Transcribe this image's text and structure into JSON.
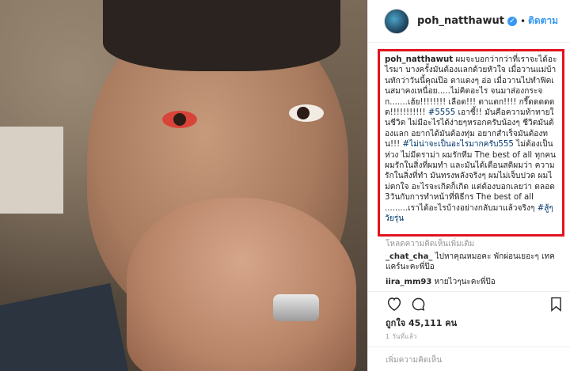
{
  "post": {
    "username": "poh_natthawut",
    "follow_label": "ติดตาม",
    "caption_user": "poh_natthawut",
    "caption_text_1": "ผมจะบอกว่ากว่าที่เราจะได้อะไรมา บางครั้งมันต้องแลกด้วยหัวใจ เมื่อวานแม่บ้านทักว่าวันนี้คุณป๊อ ตาแดงๆ อ่อ เมื่อวานไปทำฟิตเนสมาคงเหนื่อย.....ไม่คิดอะไร จนมาส่องกระจก.......เฮ้ย!!!!!!!! เลือด!!! ตาแตก!!!! กรี๊ดดดดดด!!!!!!!!!!! ",
    "caption_tag_1": "#5555",
    "caption_text_2": " เอาชี้!! มันคือความท้าทายในชีวิต ไม่มีอะไรได้ง่ายๆหรอกครับน้องๆ ชีวิตมันต้องแลก อยากได้มันต้องทุ่ม อยากสำเร็จมันต้องทน!!! ",
    "caption_tag_2": "#ไม่น่าจะเป็นอะไรมากครับ555",
    "caption_text_3": " ไม่ต้องเป็นห่วง ไม่มีดราม่า ผมรักทีม The best of all ทุกคน ผมรักในสิ่งที่ผมทำ และมันได้เตือนสติผมว่า ความรักในสิ่งที่ทำ มันทรงพลังจริงๆ ผมไม่เจ็บปวด ผมไม่ตกใจ อะไรจะเกิดก็เกิด แต่ต้องบอกเลยว่า ตลอด3วันกับการทำหน้าที่พิธีกร The best of all .........เราได้อะไรบ้างอย่างกลับมาแล้วจริงๆ ",
    "caption_tag_3": "#สู้ๆวัยรุ่น",
    "more_comments": "โหลดความคิดเห็นเพิ่มเติม",
    "comments": [
      {
        "user": "_chat_cha_",
        "text": "ไปหาคุณหมอคะ พักผ่อนเยอะๆ เทคแคร์นะคะพี่ป๊อ"
      },
      {
        "user": "iira_mm93",
        "text": "หายไวๆนะคะพี่ป๊อ"
      }
    ],
    "likes": "ถูกใจ 45,111 คน",
    "time": "1 วันที่แล้ว",
    "add_comment_placeholder": "เพิ่มความคิดเห็น"
  },
  "icons": {
    "verified": "verified-badge-icon",
    "heart": "heart-icon",
    "comment": "comment-icon",
    "bookmark": "bookmark-icon"
  },
  "colors": {
    "accent": "#3897f0",
    "highlight_border": "#e0141e",
    "hashtag": "#003569"
  }
}
